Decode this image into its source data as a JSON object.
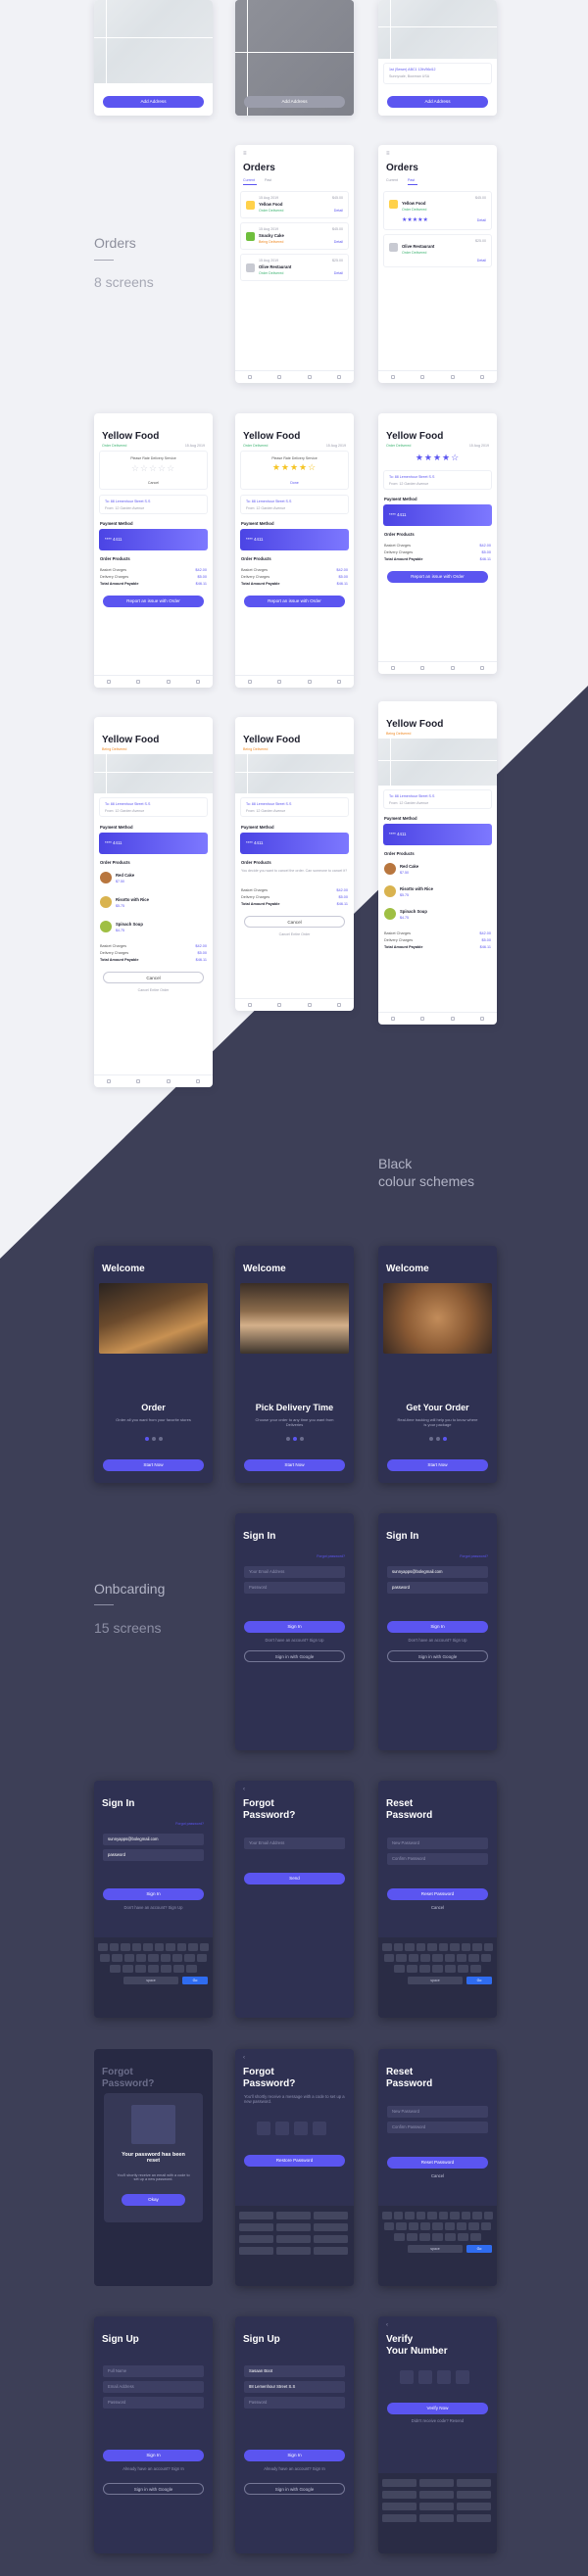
{
  "sections": {
    "orders_label": "Orders",
    "orders_count": "8 screens",
    "black_label_1": "Black",
    "black_label_2": "colour schemes",
    "onboarding_label": "Onbcarding",
    "onboarding_count": "15 screens"
  },
  "address": {
    "add_button": "Add Address",
    "saved_address": "1st (Sewer) ABC1 12th/56d12",
    "saved_sub": "Sunnyvale, Bowman USA"
  },
  "orders": {
    "title": "Orders",
    "tab_current": "Current",
    "tab_past": "Past",
    "items": [
      {
        "name": "Yellow Food",
        "price": "$45.00",
        "status": "Order Delivered",
        "action": "Detail"
      },
      {
        "name": "Snacky Cake",
        "price": "$45.00",
        "status": "Being Delivered",
        "action": "Detail"
      },
      {
        "name": "Olive Restaurant",
        "price": "$25.00",
        "status": "Order Delivered",
        "action": "Detail"
      }
    ],
    "past_items": [
      {
        "name": "Yellow Food",
        "price": "$45.00",
        "status": "Order Delivered",
        "action": "Detail"
      },
      {
        "name": "Olive Restaurant",
        "price": "$25.00",
        "status": "Order Delivered",
        "action": "Detail"
      }
    ]
  },
  "detail": {
    "title": "Yellow Food",
    "status": "Order Delivered",
    "date": "15 Aug 2019",
    "rate_prompt": "Please Rate Delivery Service",
    "cancel": "Cancel",
    "done": "Done",
    "address_line": "To: 88 Lemenhour Street S.S",
    "address_sub": "From: 12 Garden Avenue",
    "payment_label": "Payment Method",
    "card_mask": "****  4411",
    "products_label": "Order Products",
    "basket": "Basket Charges",
    "basket_value": "$42.00",
    "delivery": "Delivery Charges",
    "delivery_value": "$5.00",
    "total": "Total Amount Payable",
    "total_value": "$46.11",
    "report": "Report an issue with Order",
    "cancel_order": "Cancel Entire Order",
    "cancel_note": "You decide you want to cancel the order. Can someone to cancel it?",
    "products": [
      {
        "name": "Red Cake",
        "price": "$7.50"
      },
      {
        "name": "Risotto with Rice",
        "price": "$5.75"
      },
      {
        "name": "Spinach Soup",
        "price": "$4.75"
      }
    ]
  },
  "welcome": {
    "title": "Welcome",
    "screens": [
      {
        "heading": "Order",
        "body": "Order all you want from your favorite stores",
        "button": "Start Now"
      },
      {
        "heading": "Pick Delivery Time",
        "body": "Choose your order to any time you want from Deliveries",
        "button": "Start Now"
      },
      {
        "heading": "Get Your Order",
        "body": "Real-time tracking will help you to know where is your package",
        "button": "Start Now"
      }
    ]
  },
  "signin": {
    "title": "Sign In",
    "forgot": "Forgot password?",
    "email_placeholder": "Your Email Address",
    "password_placeholder": "Password",
    "email_value": "sunnyapps@bolegmail.com",
    "password_value": "password",
    "button": "Sign In",
    "signup_prompt": "Don't have an account? Sign Up",
    "google": "Sign in with Google"
  },
  "forgot": {
    "title_1": "Forgot",
    "title_2": "Password?",
    "email_placeholder": "Your Email Address",
    "send": "Send",
    "sent_title": "Your password has been reset",
    "sent_body": "You'll shortly receive an email with a code to set up a new password.",
    "okay": "Okay",
    "code_prompt": "You'll shortly receive a message with a code to set up a new password.",
    "restore": "Restore Password"
  },
  "reset": {
    "title_1": "Reset",
    "title_2": "Password",
    "new_placeholder": "New Password",
    "confirm_placeholder": "Confirm Password",
    "button": "Reset Password",
    "cancel": "Cancel"
  },
  "signup": {
    "title": "Sign Up",
    "name_placeholder": "Full Name",
    "email_placeholder": "Email Address",
    "password_placeholder": "Password",
    "name_value": "Sasaan Boot",
    "email_value": "88 Lemenhour Street S.S",
    "button": "Sign In",
    "signin_prompt": "Already have an account? Sign In",
    "google": "Sign in with Google"
  },
  "verify": {
    "title_1": "Verify",
    "title_2": "Your Number",
    "button": "Verify Now",
    "resend": "Didn't receive code? Resend"
  },
  "keyboard": {
    "space": "space",
    "go": "Go"
  },
  "colors": {
    "accent": "#5b55f0",
    "dark_bg": "#3d3f57",
    "dark_card": "#2f3152",
    "light_bg": "#f1f2f6"
  }
}
